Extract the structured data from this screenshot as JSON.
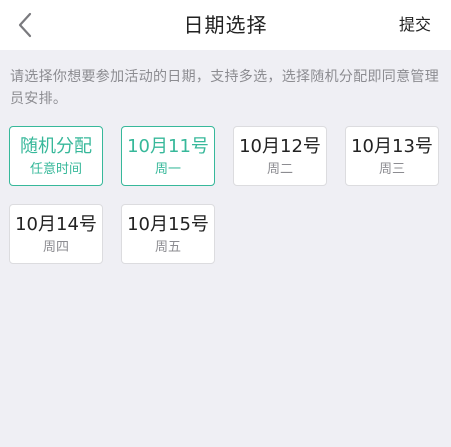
{
  "navbar": {
    "back_icon": "chevron-left-icon",
    "title": "日期选择",
    "submit_label": "提交"
  },
  "hint": "请选择你想要参加活动的日期，支持多选，选择随机分配即同意管理员安排。",
  "options": [
    {
      "main": "随机分配",
      "sub": "任意时间",
      "selected": true
    },
    {
      "main": "10月11号",
      "sub": "周一",
      "selected": true
    },
    {
      "main": "10月12号",
      "sub": "周二",
      "selected": false
    },
    {
      "main": "10月13号",
      "sub": "周三",
      "selected": false
    },
    {
      "main": "10月14号",
      "sub": "周四",
      "selected": false
    },
    {
      "main": "10月15号",
      "sub": "周五",
      "selected": false
    }
  ],
  "colors": {
    "accent": "#37b89a",
    "background": "#efeff4",
    "text": "#222222",
    "muted": "#8c8c91"
  }
}
